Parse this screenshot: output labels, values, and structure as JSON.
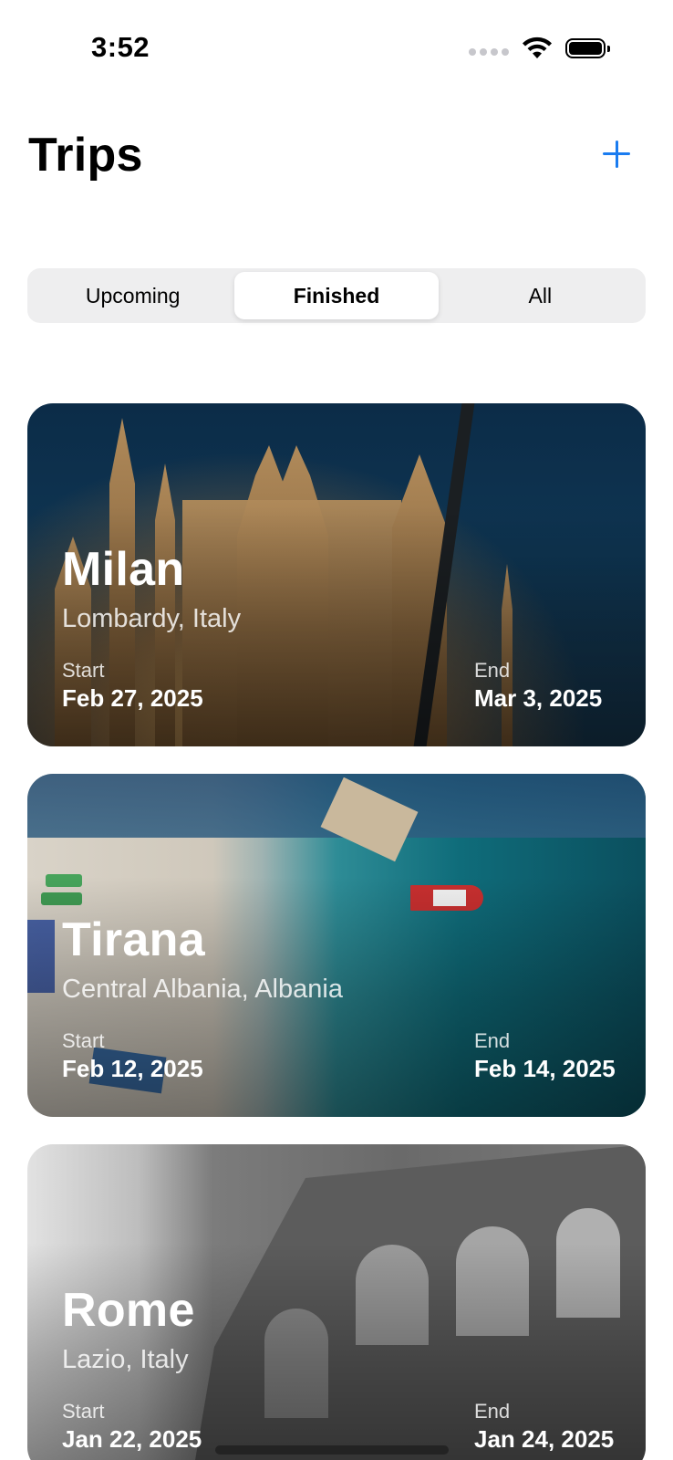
{
  "status_bar": {
    "time": "3:52"
  },
  "header": {
    "title": "Trips",
    "add_icon": "plus-icon"
  },
  "accent_color": "#1a7cf0",
  "segments": [
    {
      "label": "Upcoming",
      "selected": false
    },
    {
      "label": "Finished",
      "selected": true
    },
    {
      "label": "All",
      "selected": false
    }
  ],
  "trips": [
    {
      "city": "Milan",
      "region": "Lombardy, Italy",
      "start_label": "Start",
      "start": "Feb 27, 2025",
      "end_label": "End",
      "end": "Mar 3, 2025",
      "image": "milan-cathedral-night"
    },
    {
      "city": "Tirana",
      "region": "Central Albania, Albania",
      "start_label": "Start",
      "start": "Feb 12, 2025",
      "end_label": "End",
      "end": "Feb 14, 2025",
      "image": "aerial-beach-turquoise-water"
    },
    {
      "city": "Rome",
      "region": "Lazio, Italy",
      "start_label": "Start",
      "start": "Jan 22, 2025",
      "end_label": "End",
      "end": "Jan 24, 2025",
      "image": "colosseum-grayscale"
    }
  ]
}
